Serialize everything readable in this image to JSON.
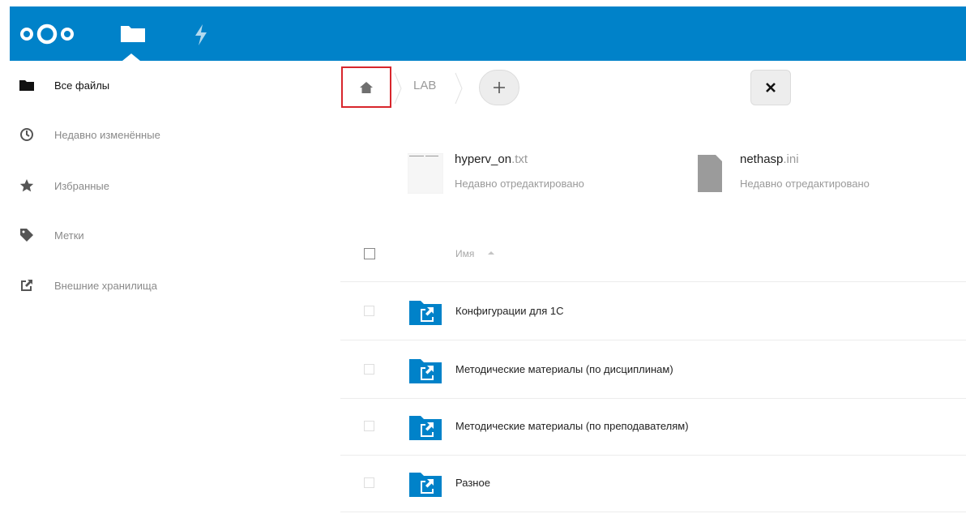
{
  "header": {
    "logo_icon": "nextcloud-logo",
    "nav": [
      {
        "icon": "folder-icon",
        "active": true
      },
      {
        "icon": "lightning-icon",
        "active": false
      }
    ],
    "accent_color": "#0082c9"
  },
  "sidebar": {
    "items": [
      {
        "label": "Все файлы",
        "icon": "folder-icon",
        "active": true
      },
      {
        "label": "Недавно изменённые",
        "icon": "clock-icon",
        "active": false
      },
      {
        "label": "Избранные",
        "icon": "star-icon",
        "active": false
      },
      {
        "label": "Метки",
        "icon": "tag-icon",
        "active": false
      },
      {
        "label": "Внешние хранилища",
        "icon": "external-link-icon",
        "active": false
      }
    ]
  },
  "breadcrumb": {
    "home_icon": "home-icon",
    "items": [
      "LAB"
    ],
    "add_icon": "plus-icon",
    "close_icon": "close-icon"
  },
  "recent": [
    {
      "name": "hyperv_on",
      "ext": ".txt",
      "subtitle": "Недавно отредактировано"
    },
    {
      "name": "nethasp",
      "ext": ".ini",
      "subtitle": "Недавно отредактировано"
    }
  ],
  "table": {
    "column_name": "Имя",
    "rows": [
      {
        "name": "Конфигурации для 1С"
      },
      {
        "name": "Методические материалы (по дисциплинам)"
      },
      {
        "name": "Методические материалы (по преподавателям)"
      },
      {
        "name": "Разное"
      }
    ]
  }
}
